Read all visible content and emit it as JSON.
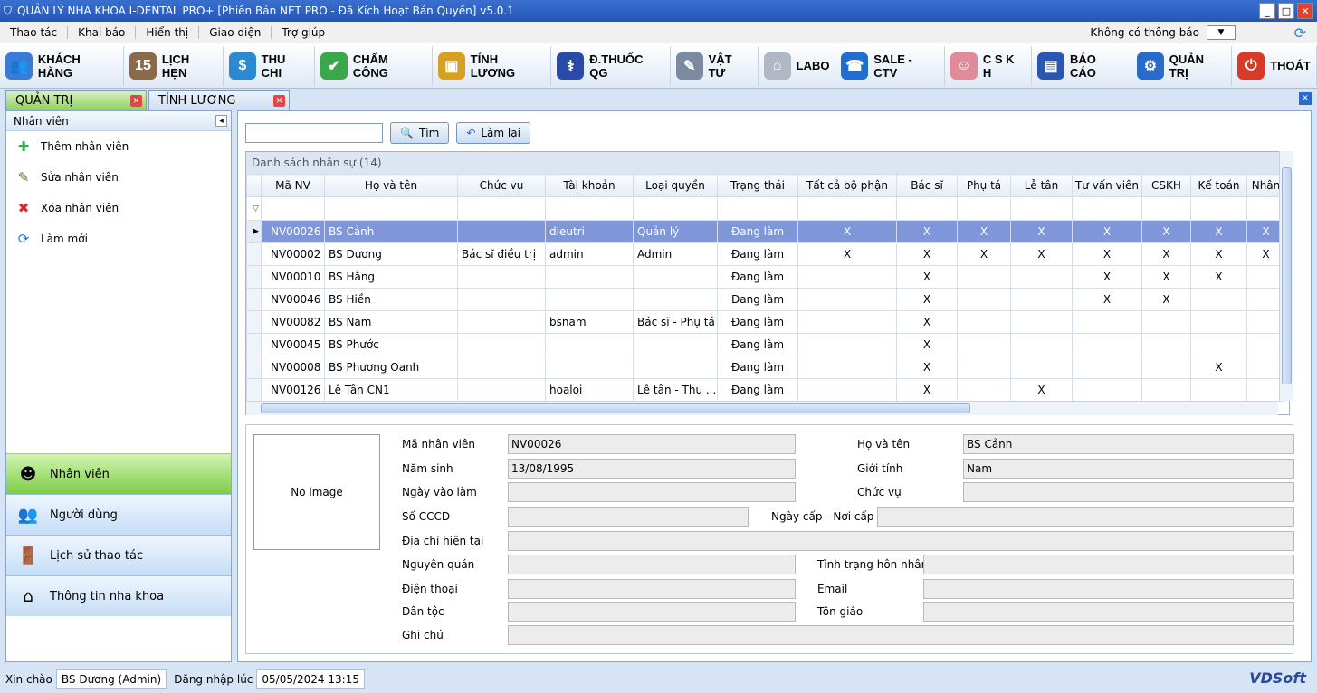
{
  "window": {
    "title": "QUẢN LÝ NHA KHOA I-DENTAL PRO+ [Phiên Bản NET PRO - Đã Kích Hoạt Bản Quyền] v5.0.1"
  },
  "menu": {
    "items": [
      "Thao tác",
      "Khai báo",
      "Hiển thị",
      "Giao diện",
      "Trợ giúp"
    ],
    "notification": "Không có thông báo"
  },
  "toolbar": [
    {
      "label": "KHÁCH HÀNG",
      "icon": "customers-icon",
      "color": "#3a7bd5",
      "glyph": "👥"
    },
    {
      "label": "LỊCH HẸN",
      "icon": "calendar-icon",
      "color": "#8a6a4a",
      "glyph": "15"
    },
    {
      "label": "THU CHI",
      "icon": "dollar-icon",
      "color": "#2a8ad0",
      "glyph": "$"
    },
    {
      "label": "CHẤM CÔNG",
      "icon": "shield-check-icon",
      "color": "#3aa84a",
      "glyph": "✔"
    },
    {
      "label": "TÍNH LƯƠNG",
      "icon": "wallet-icon",
      "color": "#d8a020",
      "glyph": "▣"
    },
    {
      "label": "Đ.THUỐC QG",
      "icon": "medicine-icon",
      "color": "#2a4aa8",
      "glyph": "⚕"
    },
    {
      "label": "VẬT TƯ",
      "icon": "tools-icon",
      "color": "#7a8aa0",
      "glyph": "✎"
    },
    {
      "label": "LABO",
      "icon": "tooth-icon",
      "color": "#b0b8c4",
      "glyph": "⌂"
    },
    {
      "label": "SALE - CTV",
      "icon": "phone-icon",
      "color": "#1f6ed0",
      "glyph": "☎"
    },
    {
      "label": "C S K H",
      "icon": "support-agent-icon",
      "color": "#e08a9a",
      "glyph": "☺"
    },
    {
      "label": "BÁO CÁO",
      "icon": "report-chart-icon",
      "color": "#2a58b0",
      "glyph": "▤"
    },
    {
      "label": "QUẢN TRỊ",
      "icon": "gear-icon",
      "color": "#2a6acb",
      "glyph": "⚙"
    },
    {
      "label": "THOÁT",
      "icon": "power-icon",
      "color": "#d83a2a",
      "glyph": "⏻"
    }
  ],
  "tabs": [
    {
      "label": "QUẢN TRỊ",
      "active": true
    },
    {
      "label": "TÍNH LƯƠNG",
      "active": false
    }
  ],
  "left_panel": {
    "header": "Nhân viên",
    "actions": [
      {
        "label": "Thêm nhân viên",
        "icon": "add-icon",
        "glyph": "✚",
        "color": "#2aa84a"
      },
      {
        "label": "Sửa nhân viên",
        "icon": "edit-icon",
        "glyph": "✎",
        "color": "#7a6a3a"
      },
      {
        "label": "Xóa nhân viên",
        "icon": "delete-icon",
        "glyph": "✖",
        "color": "#d82a2a"
      },
      {
        "label": "Làm mới",
        "icon": "refresh-icon",
        "glyph": "⟳",
        "color": "#2a7ad8"
      }
    ],
    "nav": [
      {
        "label": "Nhân viên",
        "icon": "doctor-icon",
        "glyph": "☻",
        "active": true
      },
      {
        "label": "Người dùng",
        "icon": "users-icon",
        "glyph": "👥",
        "active": false
      },
      {
        "label": "Lịch sử thao tác",
        "icon": "door-icon",
        "glyph": "🚪",
        "active": false
      },
      {
        "label": "Thông tin nha khoa",
        "icon": "clinic-home-icon",
        "glyph": "⌂",
        "active": false
      }
    ]
  },
  "search": {
    "value": "",
    "search_label": "Tìm",
    "reset_label": "Làm lại"
  },
  "grid": {
    "caption": "Danh sách nhân sự (14)",
    "columns": [
      "Mã NV",
      "Họ và tên",
      "Chức vụ",
      "Tài khoản",
      "Loại quyền",
      "Trạng thái",
      "Tất cả bộ phận",
      "Bác sĩ",
      "Phụ tá",
      "Lễ tân",
      "Tư vấn viên",
      "CSKH",
      "Kế toán",
      "Nhân"
    ],
    "rows": [
      [
        "NV00026",
        "BS Cảnh",
        "",
        "dieutri",
        "Quản lý",
        "Đang làm",
        "X",
        "X",
        "X",
        "X",
        "X",
        "X",
        "X",
        "X"
      ],
      [
        "NV00002",
        "BS Dương",
        "Bác sĩ điều trị",
        "admin",
        "Admin",
        "Đang làm",
        "X",
        "X",
        "X",
        "X",
        "X",
        "X",
        "X",
        "X"
      ],
      [
        "NV00010",
        "BS Hằng",
        "",
        "",
        "",
        "Đang làm",
        "",
        "X",
        "",
        "",
        "X",
        "X",
        "X",
        ""
      ],
      [
        "NV00046",
        "BS Hiền",
        "",
        "",
        "",
        "Đang làm",
        "",
        "X",
        "",
        "",
        "X",
        "X",
        "",
        ""
      ],
      [
        "NV00082",
        "BS Nam",
        "",
        "bsnam",
        "Bác sĩ - Phụ tá",
        "Đang làm",
        "",
        "X",
        "",
        "",
        "",
        "",
        "",
        ""
      ],
      [
        "NV00045",
        "BS Phước",
        "",
        "",
        "",
        "Đang làm",
        "",
        "X",
        "",
        "",
        "",
        "",
        "",
        ""
      ],
      [
        "NV00008",
        "BS Phương Oanh",
        "",
        "",
        "",
        "Đang làm",
        "",
        "X",
        "",
        "",
        "",
        "",
        "X",
        ""
      ],
      [
        "NV00126",
        "Lễ Tân CN1",
        "",
        "hoaloi",
        "Lễ tân - Thu ...",
        "Đang làm",
        "",
        "X",
        "",
        "X",
        "",
        "",
        "",
        ""
      ]
    ]
  },
  "detail": {
    "no_image": "No image",
    "labels": {
      "ma_nv": "Mã nhân viên",
      "ho_ten": "Họ và tên",
      "nam_sinh": "Năm sinh",
      "gioi_tinh": "Giới tính",
      "ngay_vao_lam": "Ngày vào làm",
      "chuc_vu": "Chức vụ",
      "cccd": "Số CCCD",
      "ngay_cap": "Ngày cấp - Nơi cấp",
      "dia_chi": "Địa chỉ hiện tại",
      "nguyen_quan": "Nguyên quán",
      "hon_nhan": "Tình trạng hôn nhân",
      "dien_thoai": "Điện thoại",
      "email": "Email",
      "dan_toc": "Dân tộc",
      "ton_giao": "Tôn giáo",
      "ghi_chu": "Ghi chú"
    },
    "values": {
      "ma_nv": "NV00026",
      "ho_ten": "BS Cảnh",
      "nam_sinh": "13/08/1995",
      "gioi_tinh": "Nam",
      "ngay_vao_lam": "",
      "chuc_vu": "",
      "cccd": "",
      "ngay_cap": "",
      "dia_chi": "",
      "nguyen_quan": "",
      "hon_nhan": "",
      "dien_thoai": "",
      "email": "",
      "dan_toc": "",
      "ton_giao": "",
      "ghi_chu": ""
    }
  },
  "status": {
    "greeting": "Xin chào",
    "user": "BS Dương (Admin)",
    "login_label": "Đăng nhập lúc",
    "login_time": "05/05/2024 13:15",
    "logo": "VDSoft"
  }
}
